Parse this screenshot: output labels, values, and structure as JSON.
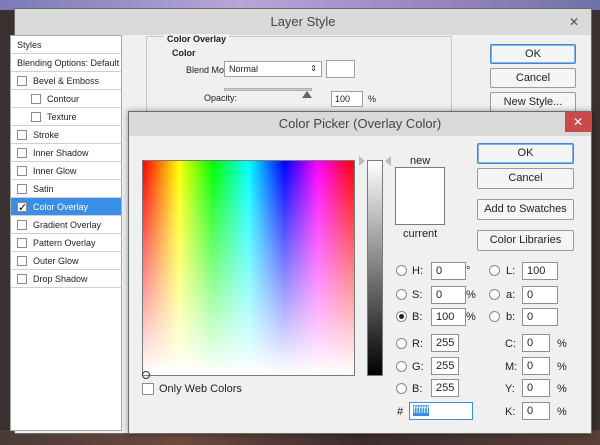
{
  "layer_style": {
    "title": "Layer Style",
    "styles_list": [
      {
        "label": "Styles",
        "checkbox": false,
        "checked": false,
        "selected": false,
        "indent": 0
      },
      {
        "label": "Blending Options: Default",
        "checkbox": false,
        "checked": false,
        "selected": false,
        "indent": 0
      },
      {
        "label": "Bevel & Emboss",
        "checkbox": true,
        "checked": false,
        "selected": false,
        "indent": 0
      },
      {
        "label": "Contour",
        "checkbox": true,
        "checked": false,
        "selected": false,
        "indent": 1
      },
      {
        "label": "Texture",
        "checkbox": true,
        "checked": false,
        "selected": false,
        "indent": 1
      },
      {
        "label": "Stroke",
        "checkbox": true,
        "checked": false,
        "selected": false,
        "indent": 0
      },
      {
        "label": "Inner Shadow",
        "checkbox": true,
        "checked": false,
        "selected": false,
        "indent": 0
      },
      {
        "label": "Inner Glow",
        "checkbox": true,
        "checked": false,
        "selected": false,
        "indent": 0
      },
      {
        "label": "Satin",
        "checkbox": true,
        "checked": false,
        "selected": false,
        "indent": 0
      },
      {
        "label": "Color Overlay",
        "checkbox": true,
        "checked": true,
        "selected": true,
        "indent": 0
      },
      {
        "label": "Gradient Overlay",
        "checkbox": true,
        "checked": false,
        "selected": false,
        "indent": 0
      },
      {
        "label": "Pattern Overlay",
        "checkbox": true,
        "checked": false,
        "selected": false,
        "indent": 0
      },
      {
        "label": "Outer Glow",
        "checkbox": true,
        "checked": false,
        "selected": false,
        "indent": 0
      },
      {
        "label": "Drop Shadow",
        "checkbox": true,
        "checked": false,
        "selected": false,
        "indent": 0
      }
    ],
    "section_title": "Color Overlay",
    "subsection_title": "Color",
    "blend_mode_label": "Blend Mode:",
    "blend_mode_value": "Normal",
    "opacity_label": "Opacity:",
    "opacity_value": "100",
    "opacity_unit": "%",
    "opacity_fraction": 1.0,
    "buttons": {
      "ok": "OK",
      "cancel": "Cancel",
      "new_style": "New Style..."
    }
  },
  "color_picker": {
    "title": "Color Picker (Overlay Color)",
    "close_glyph": "✕",
    "new_label": "new",
    "current_label": "current",
    "new_color": "#ffffff",
    "current_color": "#ffffff",
    "buttons": {
      "ok": "OK",
      "cancel": "Cancel",
      "add_to_swatches": "Add to Swatches",
      "color_libraries": "Color Libraries"
    },
    "hsb": {
      "h": {
        "label": "H:",
        "value": "0",
        "unit": "°"
      },
      "s": {
        "label": "S:",
        "value": "0",
        "unit": "%"
      },
      "b": {
        "label": "B:",
        "value": "100",
        "unit": "%"
      }
    },
    "rgb": {
      "r": {
        "label": "R:",
        "value": "255"
      },
      "g": {
        "label": "G:",
        "value": "255"
      },
      "b": {
        "label": "B:",
        "value": "255"
      }
    },
    "lab": {
      "l": {
        "label": "L:",
        "value": "100"
      },
      "a": {
        "label": "a:",
        "value": "0"
      },
      "b": {
        "label": "b:",
        "value": "0"
      }
    },
    "cmyk": {
      "c": {
        "label": "C:",
        "value": "0",
        "unit": "%"
      },
      "m": {
        "label": "M:",
        "value": "0",
        "unit": "%"
      },
      "y": {
        "label": "Y:",
        "value": "0",
        "unit": "%"
      },
      "k": {
        "label": "K:",
        "value": "0",
        "unit": "%"
      }
    },
    "hex_label": "#",
    "hex_value": "ffffff",
    "only_web_colors_label": "Only Web Colors",
    "only_web_colors_checked": false,
    "selected_channel": "B"
  }
}
